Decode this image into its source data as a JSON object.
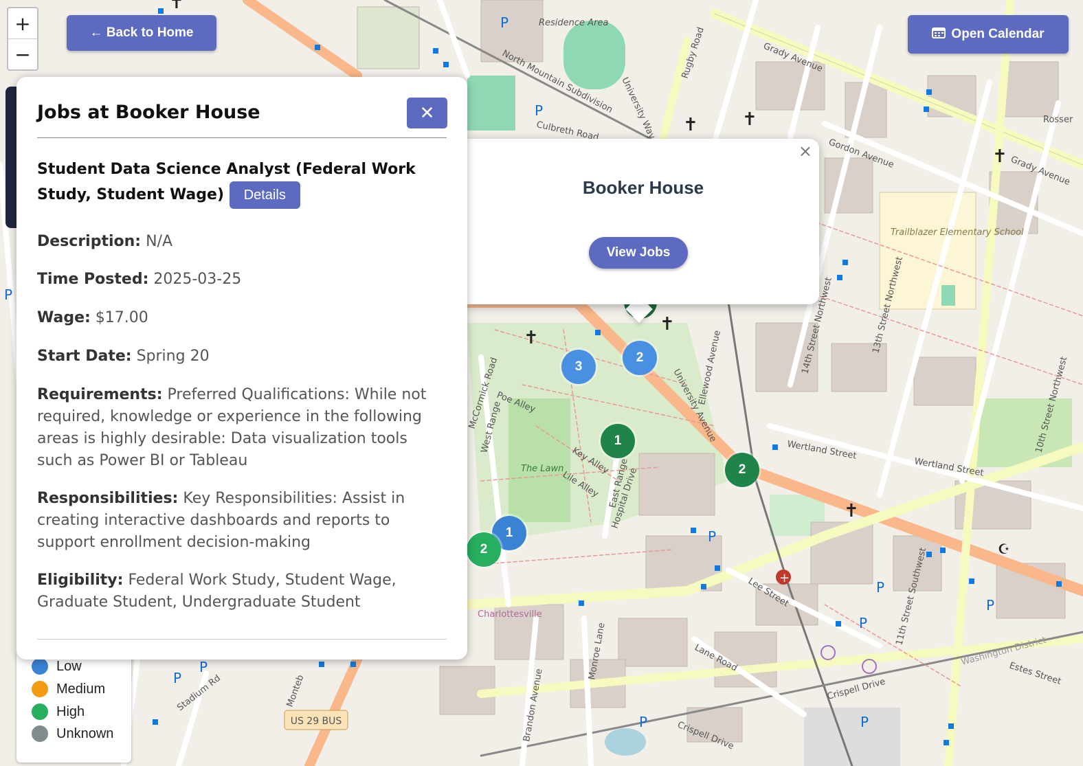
{
  "nav": {
    "zoom_in": "+",
    "zoom_out": "−",
    "back_label": "← Back to Home",
    "calendar_label": "Open Calendar",
    "calendar_icon": "calendar-icon"
  },
  "panel": {
    "title": "Jobs at Booker House",
    "close_label": "✕",
    "job_title": "Student Data Science Analyst (Federal Work Study, Student Wage)",
    "details_label": "Details",
    "fields": [
      {
        "label": "Description:",
        "value": "N/A"
      },
      {
        "label": "Time Posted:",
        "value": "2025-03-25"
      },
      {
        "label": "Wage:",
        "value": "$17.00"
      },
      {
        "label": "Start Date:",
        "value": "Spring 20"
      },
      {
        "label": "Requirements:",
        "value": "Preferred Qualifications: While not required, knowledge or experience in the following areas is highly desirable: Data visualization tools such as Power BI or Tableau"
      },
      {
        "label": "Responsibilities:",
        "value": "Key Responsibilities: Assist in creating interactive dashboards and reports to support enrollment decision-making"
      },
      {
        "label": "Eligibility:",
        "value": "Federal Work Study, Student Wage, Graduate Student, Undergraduate Student"
      }
    ]
  },
  "popup": {
    "close_label": "×",
    "title": "Booker House",
    "view_jobs_label": "View Jobs"
  },
  "legend": {
    "items": [
      {
        "label": "Low",
        "color": "#3a83d4"
      },
      {
        "label": "Medium",
        "color": "#f39c12"
      },
      {
        "label": "High",
        "color": "#27ae60"
      },
      {
        "label": "Unknown",
        "color": "#7f8c8d"
      }
    ]
  },
  "markers": [
    {
      "count": "3",
      "color": "#4a90e2"
    },
    {
      "count": "2",
      "color": "#4a90e2"
    },
    {
      "count": "1",
      "color": "#1e8449"
    },
    {
      "count": "2",
      "color": "#1e8449"
    },
    {
      "count": "1",
      "color": "#3a83d4"
    },
    {
      "count": "2",
      "color": "#27ae60"
    }
  ],
  "map_labels": {
    "grady": "Grady Avenue",
    "grady2": "Grady Avenue",
    "rugby": "Rugby Road",
    "north_mountain": "North Mountain Subdivision",
    "university_way": "University Way",
    "culbreth": "Culbreth Road",
    "gordon": "Gordon Avenue",
    "rosser": "Rosser",
    "trailblazer": "Trailblazer Elementary School",
    "university_ave": "University Avenue",
    "mccormick": "McCormick Road",
    "poe": "Poe Alley",
    "west_range": "West Range",
    "the_lawn": "The Lawn",
    "key_alley": "Key Alley",
    "lile_alley": "Lile Alley",
    "east_range": "East Range",
    "hospital": "Hospital Drive",
    "ellewood": "Ellewood Avenue",
    "wertland": "Wertland Street",
    "wertland2": "Wertland Street",
    "fourteenth": "14th Street Northwest",
    "thirteenth": "13th Street Northwest",
    "lee": "Lee Street",
    "lane": "Lane Road",
    "crispell": "Crispell Drive",
    "crispell2": "Crispell Drive",
    "charlottesville": "Charlottesville",
    "us29": "US 29 BUS",
    "monroe": "Monroe Lane",
    "brandon": "Brandon Avenue",
    "stadium": "Stadium Rd",
    "monteb": "Monteb",
    "washington": "Washington District",
    "estes": "Estes Street",
    "tenth": "10th Street Northwest",
    "eleventh": "11th Street Southwest",
    "residence": "Residence Area"
  }
}
